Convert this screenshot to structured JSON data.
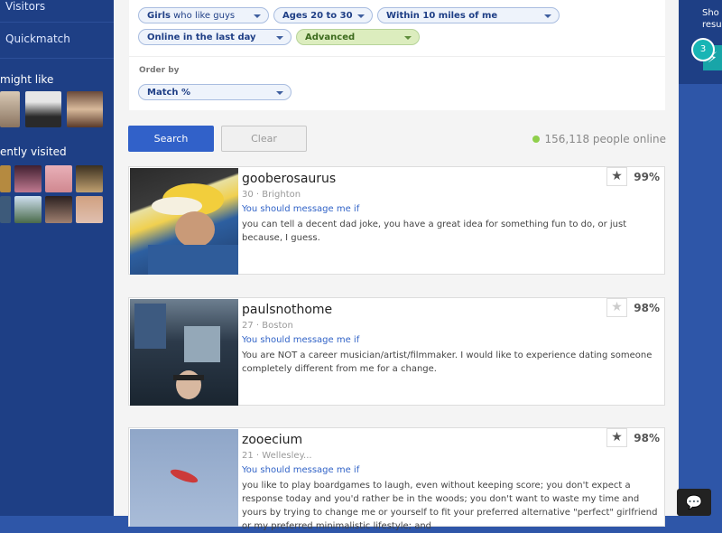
{
  "sidebar": {
    "visitors_label": "Visitors",
    "quickmatch_label": "Quickmatch",
    "might_like_heading": "might like",
    "recently_visited_heading": "ently visited"
  },
  "filters": {
    "gender": {
      "bold": "Girls",
      "rest": " who like guys"
    },
    "age": {
      "bold": "Ages 20 to 30"
    },
    "distance": {
      "bold": "Within 10 miles of me"
    },
    "online": {
      "bold": "Online in the last day"
    },
    "advanced": {
      "bold": "Advanced"
    },
    "order_label": "Order by",
    "order_value": "Match %"
  },
  "actions": {
    "search_label": "Search",
    "clear_label": "Clear",
    "online_count": "156,118 people online"
  },
  "results": [
    {
      "username": "gooberosaurus",
      "meta": "30 · Brighton",
      "message_prompt": "You should message me if",
      "essay": "you can tell a decent dad joke, you have a great idea for something fun to do, or just because, I guess.",
      "match": "99%",
      "starred": true
    },
    {
      "username": "paulsnothome",
      "meta": "27 · Boston",
      "message_prompt": "You should message me if",
      "essay": "You are NOT a career musician/artist/filmmaker. I would like to experience dating someone completely different from me for a change.",
      "match": "98%",
      "starred": false
    },
    {
      "username": "zooecium",
      "meta": "21 · Wellesley...",
      "message_prompt": "You should message me if",
      "essay": "you like to play boardgames to laugh, even without keeping score; you don't expect a response today and you'd rather be in the woods; you don't want to waste my time and yours by trying to change me or yourself to fit your preferred alternative \"perfect\" girlfriend or my preferred minimalistic lifestyle; and",
      "match": "98%",
      "starred": true
    }
  ],
  "right_rail": {
    "text_line1": "Sho",
    "text_line2": "resu",
    "badge_count": "3"
  },
  "icons": {
    "star": "★",
    "bolt": "⚡",
    "chat": "💬"
  }
}
